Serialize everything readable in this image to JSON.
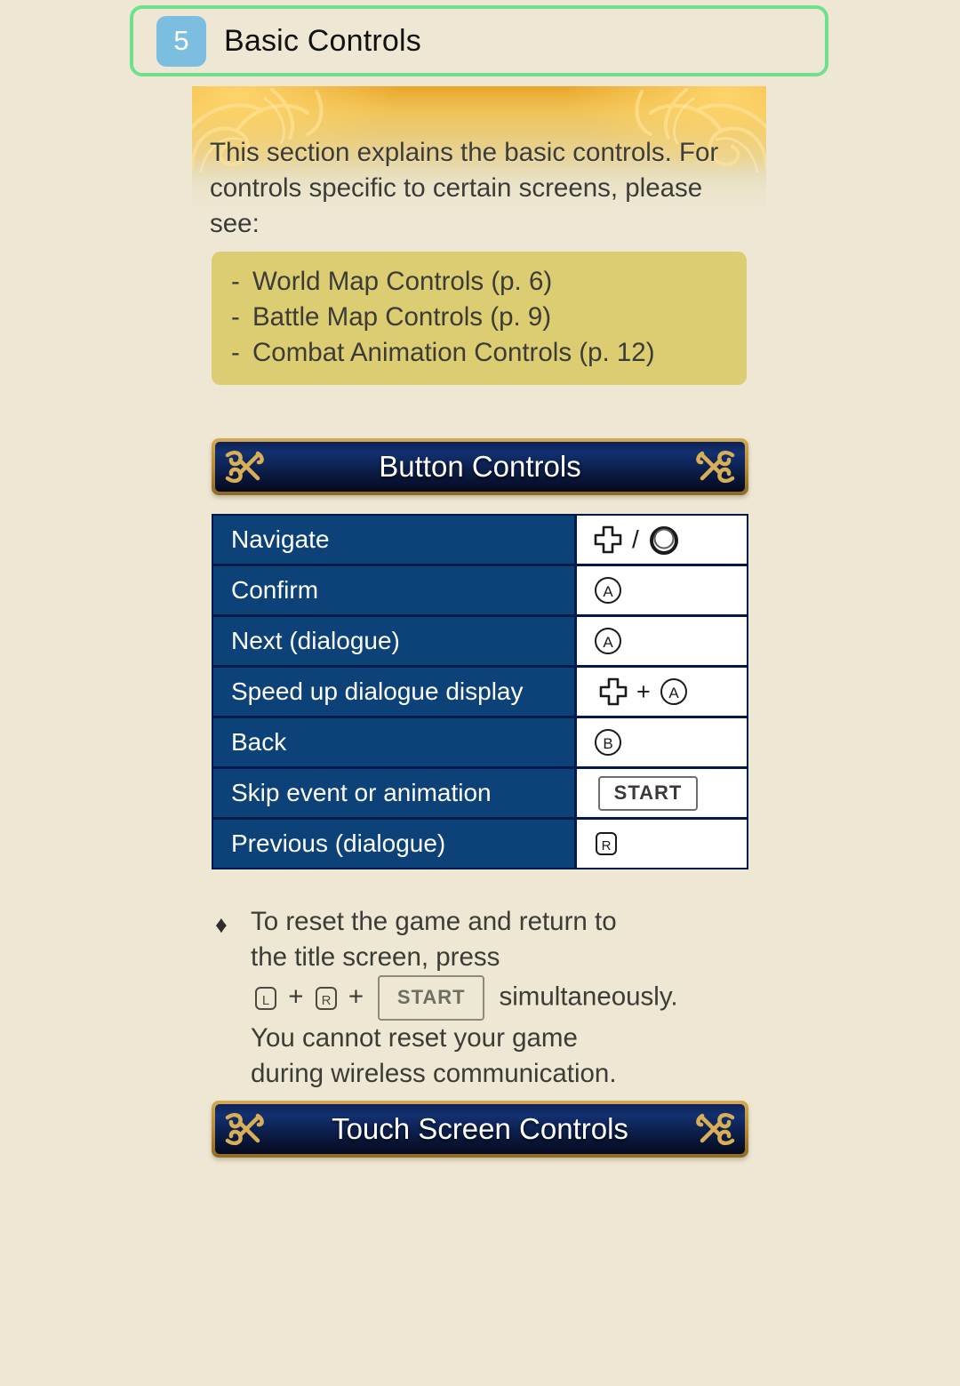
{
  "header": {
    "chapter_number": "5",
    "title": "Basic Controls",
    "badge_color": "#7CBEE0",
    "border_color": "#6FE08C"
  },
  "intro": {
    "paragraph": "This section explains the basic controls. For controls specific to certain screens, please see:"
  },
  "see_also": {
    "box_color": "#DCCC72",
    "items": [
      {
        "dash": "-",
        "text": "World Map Controls (p. 6)"
      },
      {
        "dash": "-",
        "text": "Battle Map Controls (p. 9)"
      },
      {
        "dash": "-",
        "text": "Combat Animation Controls (p. 12)"
      }
    ]
  },
  "button_controls": {
    "banner_title": "Button Controls",
    "rows": [
      {
        "action": "Navigate",
        "buttons": [
          "dpad-icon",
          "slash",
          "circle-pad-icon"
        ],
        "tall": false
      },
      {
        "action": "Confirm",
        "buttons": [
          "a-button-icon"
        ],
        "tall": false
      },
      {
        "action": "Next (dialogue)",
        "buttons": [
          "a-button-icon"
        ],
        "tall": false
      },
      {
        "action": "Speed up dialogue display",
        "buttons": [
          "dpad-icon",
          "plus",
          "a-button-icon"
        ],
        "tall": true
      },
      {
        "action": "Back",
        "buttons": [
          "b-button-icon"
        ],
        "tall": false
      },
      {
        "action": "Skip event or animation",
        "buttons": [
          "start-button-icon"
        ],
        "tall": true
      },
      {
        "action": "Previous (dialogue)",
        "buttons": [
          "r-button-icon"
        ],
        "tall": false
      }
    ],
    "glyph_labels": {
      "a": "A",
      "b": "B",
      "r": "R",
      "l": "L",
      "start": "START",
      "plus": "+",
      "slash": "/"
    },
    "cell_color": "#0C4278",
    "divider_color": "#001A4D"
  },
  "reset_note": {
    "bullet": "♦",
    "line1": "To reset the game and return to",
    "line2": "the title screen, press",
    "key_l": "L",
    "plus1": "+",
    "key_r": "R",
    "plus2": "+",
    "key_start": "START",
    "after_keys": "simultaneously.",
    "line4": "You cannot reset your game",
    "line5": "during wireless communication."
  },
  "touch_controls": {
    "banner_title": "Touch Screen Controls"
  }
}
